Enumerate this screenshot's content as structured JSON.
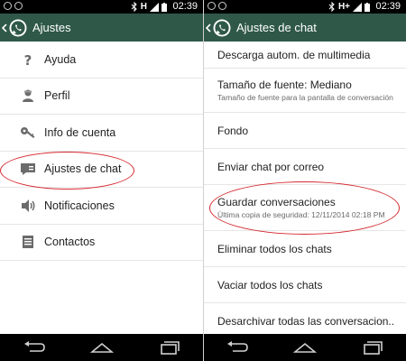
{
  "status_bar": {
    "left_screen_time": "02:39",
    "right_screen_time": "02:39",
    "left_network": "H",
    "right_network": "H+"
  },
  "left_screen": {
    "title": "Ajustes",
    "items": [
      {
        "label": "Ayuda",
        "icon": "help-icon"
      },
      {
        "label": "Perfil",
        "icon": "profile-icon"
      },
      {
        "label": "Info de cuenta",
        "icon": "key-icon"
      },
      {
        "label": "Ajustes de chat",
        "icon": "chat-settings-icon"
      },
      {
        "label": "Notificaciones",
        "icon": "speaker-icon"
      },
      {
        "label": "Contactos",
        "icon": "contacts-icon"
      }
    ]
  },
  "right_screen": {
    "title": "Ajustes de chat",
    "items": [
      {
        "title": "Descarga autom. de multimedia",
        "subtitle": ""
      },
      {
        "title": "Tamaño de fuente: Mediano",
        "subtitle": "Tamaño de fuente para la pantalla de conversación"
      },
      {
        "title": "Fondo",
        "subtitle": ""
      },
      {
        "title": "Enviar chat por correo",
        "subtitle": ""
      },
      {
        "title": "Guardar conversaciones",
        "subtitle": "Última copia de seguridad: 12/11/2014 02:18 PM"
      },
      {
        "title": "Eliminar todos los chats",
        "subtitle": ""
      },
      {
        "title": "Vaciar todos los chats",
        "subtitle": ""
      },
      {
        "title": "Desarchivar todas las conversacion..",
        "subtitle": ""
      }
    ]
  },
  "colors": {
    "action_bar": "#2f5849",
    "highlight_ellipse": "#d6292f"
  }
}
